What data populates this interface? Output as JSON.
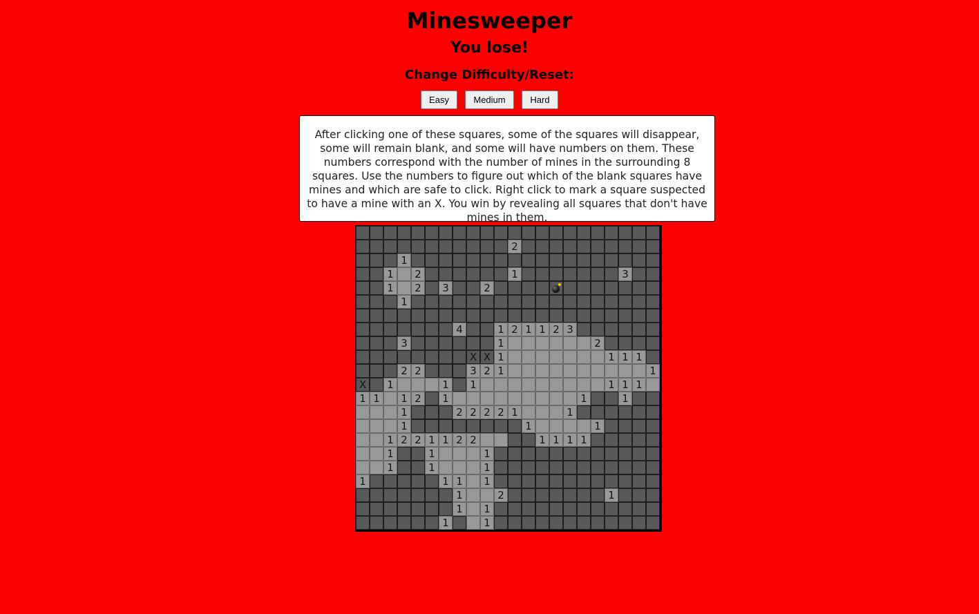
{
  "title": "Minesweeper",
  "status": "You lose!",
  "difficulty_label": "Change Difficulty/Reset:",
  "buttons": {
    "easy": "Easy",
    "medium": "Medium",
    "hard": "Hard"
  },
  "instructions": "After clicking one of these squares, some of the squares will disappear, some will remain blank, and some will have numbers on them. These numbers correspond with the number of mines in the surrounding 8 squares. Use the numbers to figure out which of the blank squares have mines and which are safe to click. Right click to mark a square suspected to have a mine with an X. You win by revealing all squares that don't have mines in them.",
  "board": {
    "legend": {
      "H": "hidden",
      "O": "revealed blank",
      "1-8": "revealed number",
      "X": "flagged",
      "B": "exploded mine"
    },
    "rows": [
      "HHHHHHHHHHHHHHHHHHHHHH",
      "HHHHHHHHHHH2HHHHHHHHHH",
      "HHH1HHHHHHHHHHHHHHHHHH",
      "HH1O2HHHHHH1HHHHHHH3HHH",
      "HH1O2H3HH2HHHHBHHHHHHH",
      "HHH1HHHHHHHHHHHHHHHHHH",
      "HHHHHHHHHHHHHHHHHHHHHH",
      "HHHHHHH4HH121123HHHHHH",
      "HHH3HHHHHH1OOOOOO2HHHH",
      "HHHHHHHHXX1OOOOOOO111HHH",
      "HHH22HHH321OOOOOOOOOO1HH",
      "XH1OOO1H1OOOOOOOOO111O1HH",
      "11O12H1OOOOOOOOO1HH1HHH",
      "OOO1HHH22221OOO1HHHHHH",
      "OOO1HHHHHHHH1OOOO1HHHHH",
      "OO1221122OOHH1111HHHHHHH",
      "OO1HH1OOO1HHHHHHHHHHHH",
      "OO1HH1OOO1HHHHHHHHHHHH",
      "1HHHHH11O1HHHHHHHHHHHH",
      "HHHHHHH1OO2HHHHHHH1HHHH",
      "HHHHHHH1O1HHHHHHHHHHHH",
      "HHHHHH1HO1HHHHHHHHHHHH"
    ]
  }
}
